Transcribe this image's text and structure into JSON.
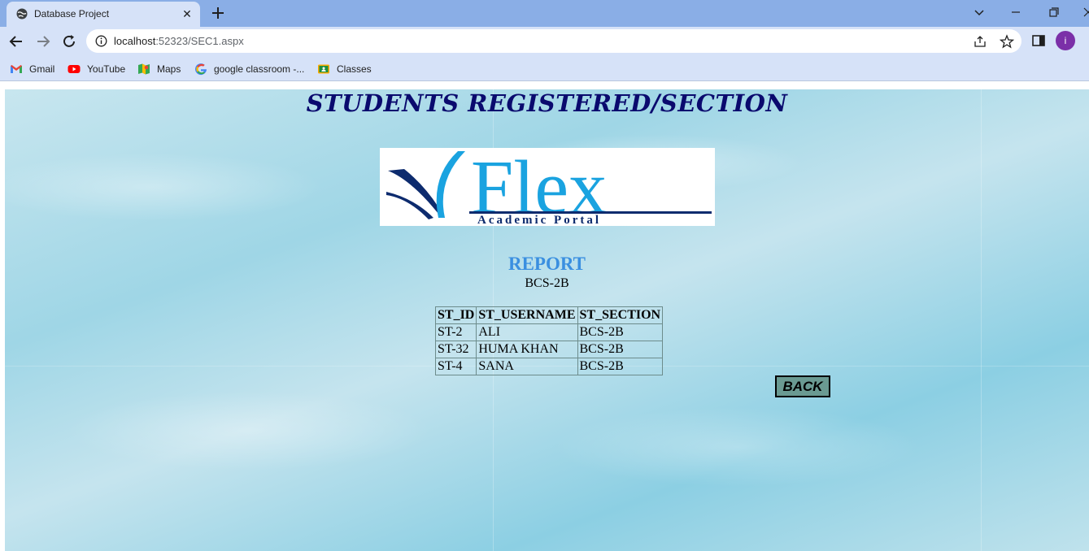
{
  "browser": {
    "tab_title": "Database Project",
    "url_host": "localhost",
    "url_rest": ":52323/SEC1.aspx",
    "avatar_letter": "i",
    "bookmarks": [
      {
        "label": "Gmail",
        "icon": "gmail-icon"
      },
      {
        "label": "YouTube",
        "icon": "youtube-icon"
      },
      {
        "label": "Maps",
        "icon": "maps-icon"
      },
      {
        "label": "google classroom -...",
        "icon": "google-icon"
      },
      {
        "label": "Classes",
        "icon": "classroom-icon"
      }
    ]
  },
  "page": {
    "heading": "STUDENTS REGISTERED/SECTION",
    "logo": {
      "word": "Flex",
      "tagline": "Academic Portal"
    },
    "report_title": "REPORT",
    "section": "BCS-2B",
    "table": {
      "headers": [
        "ST_ID",
        "ST_USERNAME",
        "ST_SECTION"
      ],
      "rows": [
        [
          "ST-2",
          "ALI",
          "BCS-2B"
        ],
        [
          "ST-32",
          "HUMA KHAN",
          "BCS-2B"
        ],
        [
          "ST-4",
          "SANA",
          "BCS-2B"
        ]
      ]
    },
    "back_label": "BACK"
  },
  "colors": {
    "heading": "#0a0a6e",
    "report_title": "#3a8fe0",
    "back_button": "#6a9a92",
    "logo_blue": "#1aa3e0",
    "logo_navy": "#0d2b6e"
  }
}
